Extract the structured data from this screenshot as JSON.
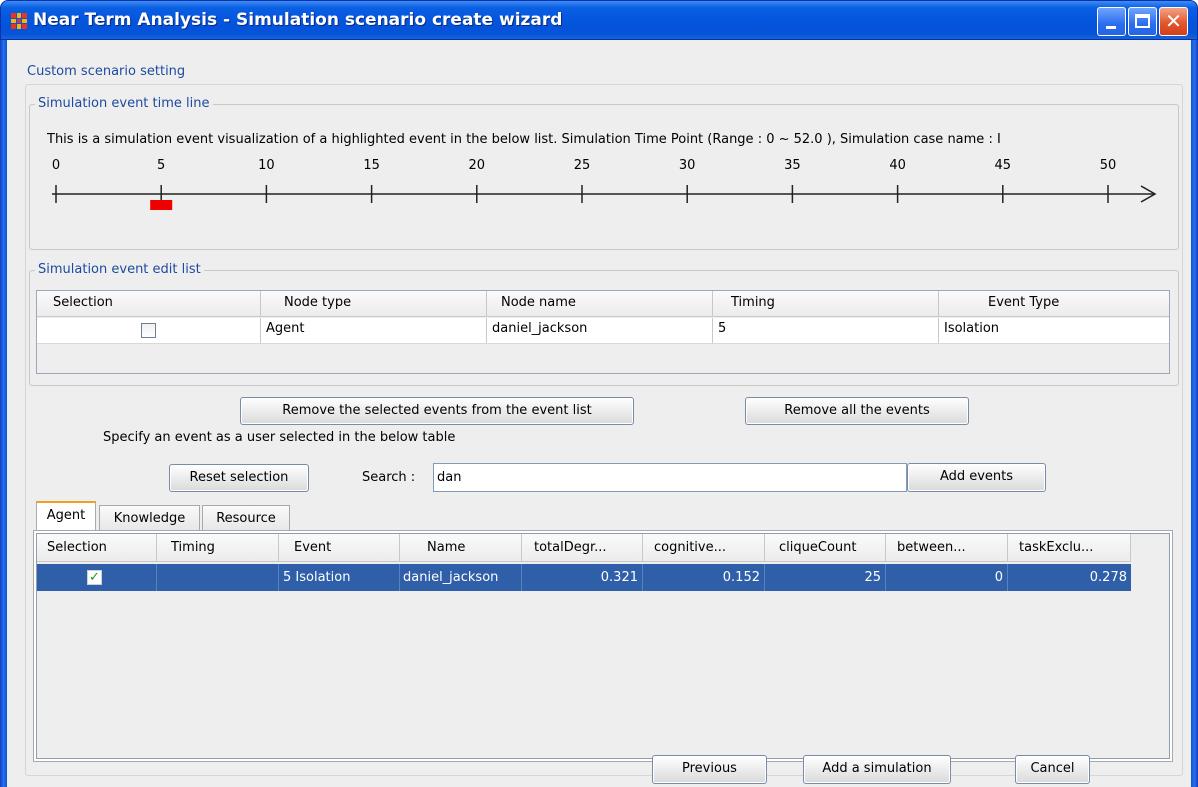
{
  "window": {
    "title": "Near Term Analysis - Simulation scenario create wizard"
  },
  "custom_scenario": {
    "legend": "Custom scenario setting"
  },
  "timeline": {
    "legend": "Simulation event time line",
    "description": "This is a simulation event visualization of a highlighted event in the below list. Simulation Time Point (Range : 0 ~ 52.0 ), Simulation case name : I",
    "ticks": [
      "0",
      "5",
      "10",
      "15",
      "20",
      "25",
      "30",
      "35",
      "40",
      "45",
      "50"
    ],
    "event_marker_time": 5,
    "marker_color": "#ee0000"
  },
  "event_list": {
    "legend": "Simulation event edit list",
    "columns": [
      "Selection",
      "Node type",
      "Node name",
      "Timing",
      "Event Type"
    ],
    "rows": [
      {
        "selected": false,
        "node_type": "Agent",
        "node_name": "daniel_jackson",
        "timing": "5",
        "event_type": "Isolation"
      }
    ]
  },
  "buttons": {
    "remove_selected": "Remove the selected events from the event list",
    "remove_all": "Remove all the events",
    "reset_selection": "Reset selection",
    "add_events": "Add events",
    "previous": "Previous",
    "add_simulation": "Add a simulation",
    "cancel": "Cancel"
  },
  "instruction": "Specify an event as a user selected in the below table",
  "search": {
    "label": "Search :",
    "value": "dan"
  },
  "tabs": [
    "Agent",
    "Knowledge",
    "Resource"
  ],
  "active_tab": "Agent",
  "node_table": {
    "columns": [
      "Selection",
      "Timing",
      "Event",
      "Name",
      "totalDegr...",
      "cognitive...",
      "cliqueCount",
      "between...",
      "taskExclu..."
    ],
    "rows": [
      {
        "selected": true,
        "timing": "",
        "event": "5 Isolation",
        "name": "daniel_jackson",
        "totalDegree": "0.321",
        "cognitive": "0.152",
        "cliqueCount": "25",
        "between": "0",
        "taskExclusivity": "0.278"
      }
    ]
  },
  "colors": {
    "selection_row": "#2f5fa8",
    "accent_tab": "#f0a020",
    "titlebar": "#0553d8"
  }
}
